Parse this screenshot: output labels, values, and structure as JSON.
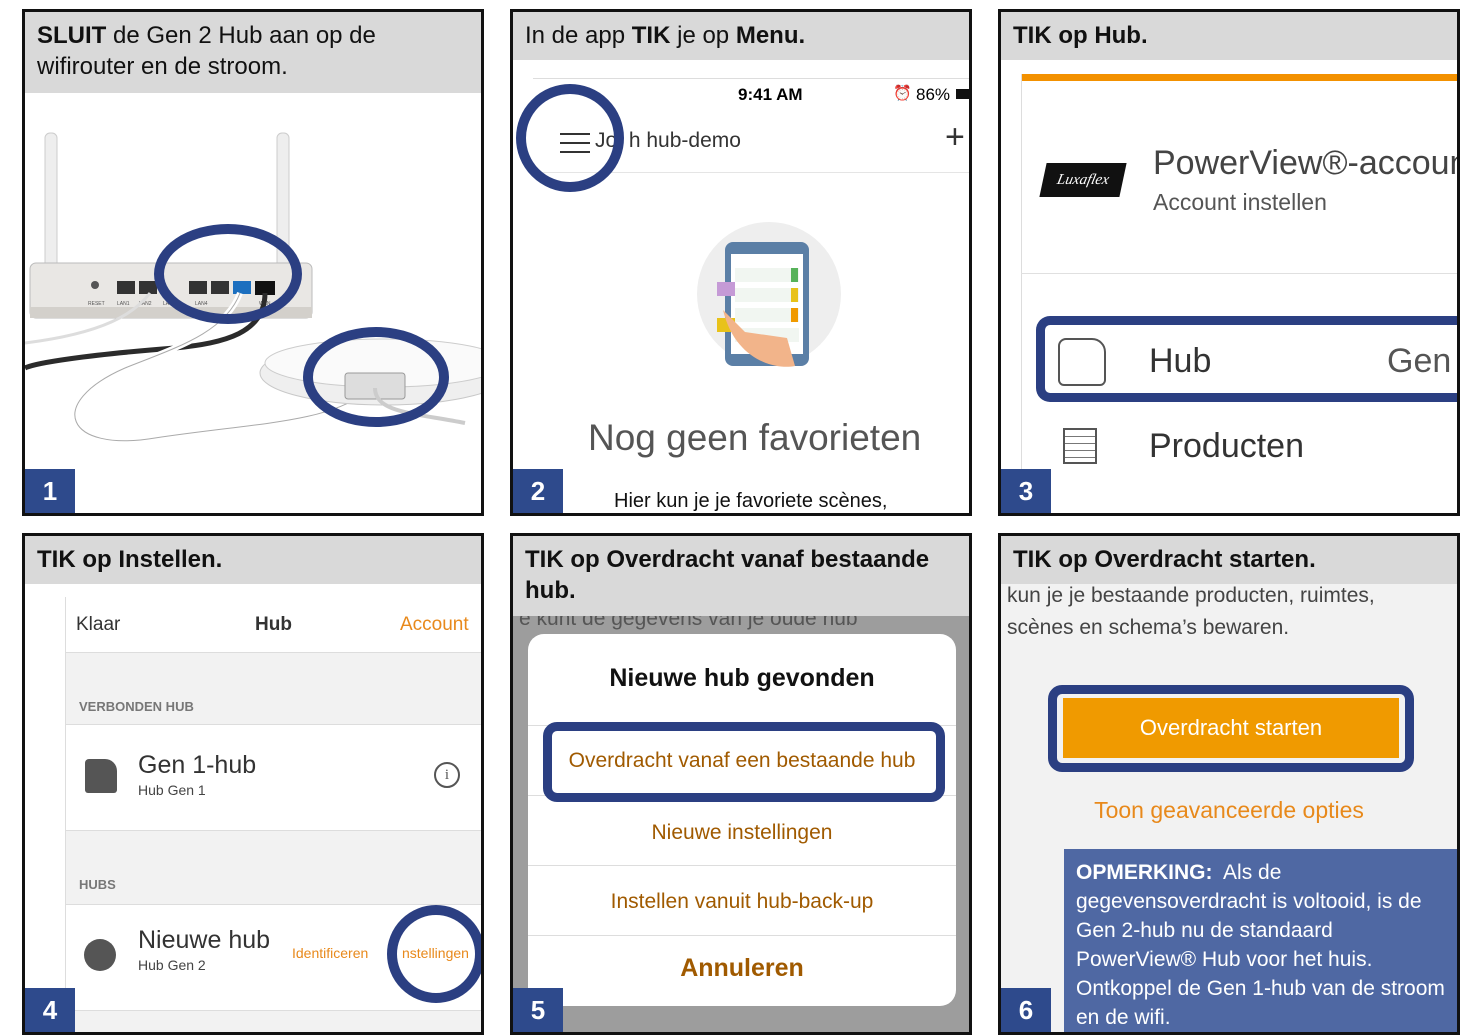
{
  "colors": {
    "accent_blue": "#2e4a8c",
    "orange": "#f09a00",
    "grey_header": "#d9d9d9"
  },
  "p1": {
    "label_bold": "SLUIT",
    "label_rest": " de Gen 2 Hub aan op de wifirouter en de stroom.",
    "num": "1",
    "router_ports": [
      "RESET",
      "LAN1",
      "LAN2",
      "LAN3",
      "LAN4",
      "WAN"
    ]
  },
  "p2": {
    "label_pre": "In de app ",
    "label_b1": "TIK",
    "label_mid": " je op ",
    "label_b2": "Menu.",
    "num": "2",
    "time": "9:41 AM",
    "battery": "86%",
    "home": "Jo  h hub-demo",
    "plus": "+",
    "empty_title": "Nog geen favorieten",
    "empty_text": "Hier kun je je favoriete scènes,"
  },
  "p3": {
    "label": "TIK op Hub.",
    "num": "3",
    "account_title": "PowerView®-accoun",
    "account_sub": "Account instellen",
    "logo": "Luxaflex",
    "hub": "Hub",
    "hub_value": "Gen",
    "products": "Producten"
  },
  "p4": {
    "label": "TIK op Instellen.",
    "num": "4",
    "nav_left": "Klaar",
    "nav_title": "Hub",
    "nav_right": "Account",
    "sec_connected": "VERBONDEN HUB",
    "hub1_name": "Gen 1-hub",
    "hub1_sub": "Hub Gen 1",
    "sec_hubs": "HUBS",
    "hub2_name": "Nieuwe hub",
    "hub2_sub": "Hub Gen 2",
    "identify": "Identificeren",
    "settings": "nstellingen"
  },
  "p5": {
    "label": "TIK op Overdracht vanaf bestaande hub.",
    "num": "5",
    "bg_text": "e kunt de gegevens van je oude hub",
    "dialog_title": "Nieuwe hub gevonden",
    "opt1": "Overdracht vanaf een bestaande hub",
    "opt2": "Nieuwe instellingen",
    "opt3": "Instellen vanuit hub-back-up",
    "cancel": "Annuleren"
  },
  "p6": {
    "label": "TIK op Overdracht starten.",
    "num": "6",
    "intro": "kun je je bestaande producten, ruimtes, scènes en schema’s bewaren.",
    "button": "Overdracht starten",
    "advanced": "Toon geavanceerde opties",
    "note_bold": "OPMERKING:",
    "note_text": "Als de gegevensoverdracht is voltooid, is de Gen 2-hub nu de standaard PowerView® Hub voor het huis. Ontkoppel de Gen 1-hub van de stroom en de wifi."
  }
}
